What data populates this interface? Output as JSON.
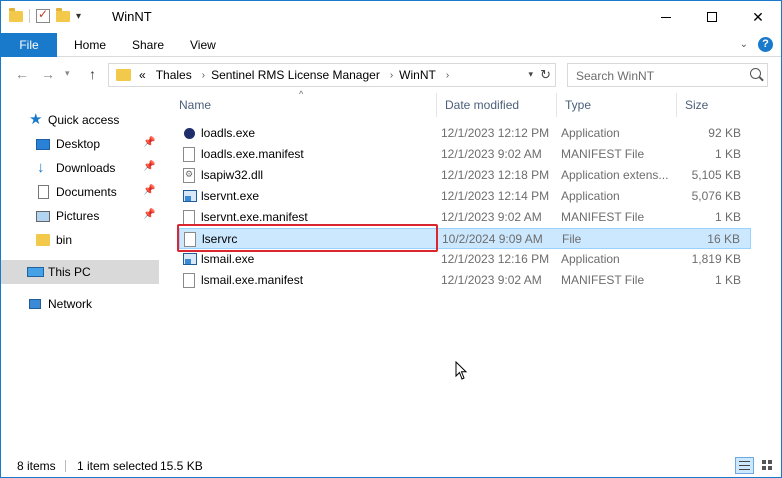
{
  "window": {
    "title": "WinNT"
  },
  "ribbon": {
    "tabs": [
      {
        "label": "File"
      },
      {
        "label": "Home"
      },
      {
        "label": "Share"
      },
      {
        "label": "View"
      }
    ]
  },
  "address": {
    "overflow": "«",
    "crumbs": [
      "Thales",
      "Sentinel RMS License Manager",
      "WinNT"
    ]
  },
  "search": {
    "placeholder": "Search WinNT"
  },
  "sidebar": {
    "quick_access": "Quick access",
    "items": [
      {
        "label": "Desktop",
        "icon": "desktop-icon",
        "pinned": true
      },
      {
        "label": "Downloads",
        "icon": "downloads-icon",
        "pinned": true
      },
      {
        "label": "Documents",
        "icon": "documents-icon",
        "pinned": true
      },
      {
        "label": "Pictures",
        "icon": "pictures-icon",
        "pinned": true
      },
      {
        "label": "bin",
        "icon": "folder-icon",
        "pinned": false
      }
    ],
    "this_pc": "This PC",
    "network": "Network"
  },
  "columns": {
    "name": "Name",
    "date": "Date modified",
    "type": "Type",
    "size": "Size"
  },
  "files": [
    {
      "name": "loadls.exe",
      "date": "12/1/2023 12:12 PM",
      "type": "Application",
      "size": "92 KB",
      "icon": "app-icon"
    },
    {
      "name": "loadls.exe.manifest",
      "date": "12/1/2023 9:02 AM",
      "type": "MANIFEST File",
      "size": "1 KB",
      "icon": "file-icon"
    },
    {
      "name": "lsapiw32.dll",
      "date": "12/1/2023 12:18 PM",
      "type": "Application extens...",
      "size": "5,105 KB",
      "icon": "dll-icon"
    },
    {
      "name": "lservnt.exe",
      "date": "12/1/2023 12:14 PM",
      "type": "Application",
      "size": "5,076 KB",
      "icon": "exe-icon"
    },
    {
      "name": "lservnt.exe.manifest",
      "date": "12/1/2023 9:02 AM",
      "type": "MANIFEST File",
      "size": "1 KB",
      "icon": "file-icon"
    },
    {
      "name": "lservrc",
      "date": "10/2/2024 9:09 AM",
      "type": "File",
      "size": "16 KB",
      "icon": "file-icon",
      "selected": true
    },
    {
      "name": "lsmail.exe",
      "date": "12/1/2023 12:16 PM",
      "type": "Application",
      "size": "1,819 KB",
      "icon": "exe-icon"
    },
    {
      "name": "lsmail.exe.manifest",
      "date": "12/1/2023 9:02 AM",
      "type": "MANIFEST File",
      "size": "1 KB",
      "icon": "file-icon"
    }
  ],
  "status": {
    "count": "8 items",
    "selected": "1 item selected",
    "size": "15.5 KB"
  },
  "colors": {
    "accent": "#1979ca",
    "selection": "#cce8ff",
    "highlight": "#d9262f"
  }
}
